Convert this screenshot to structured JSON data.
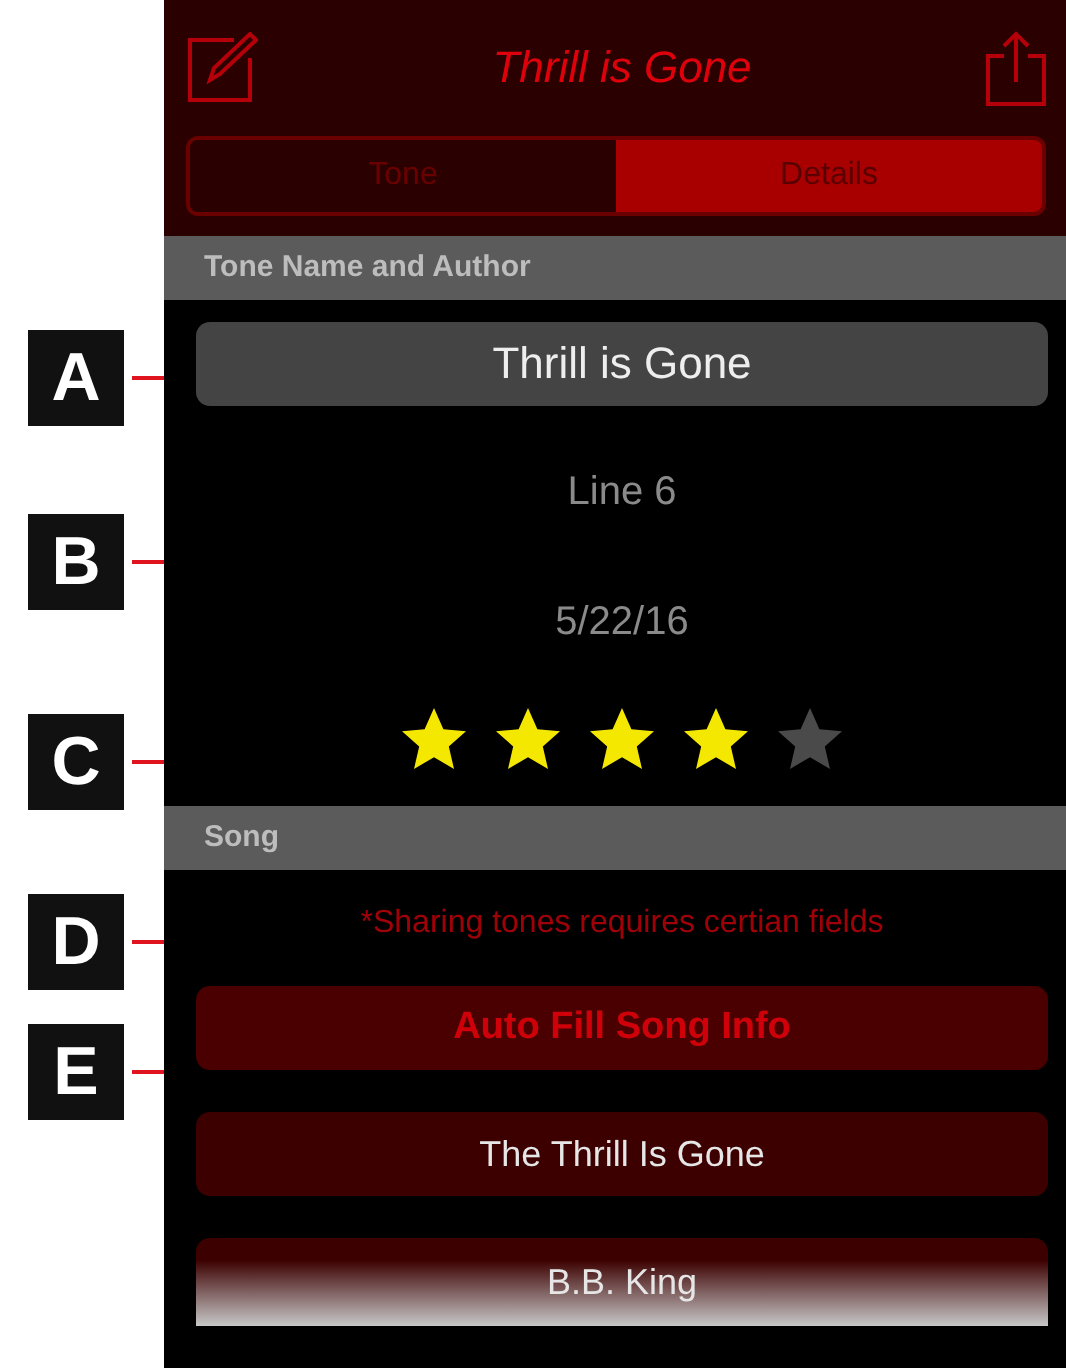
{
  "callouts": [
    {
      "letter": "A"
    },
    {
      "letter": "B"
    },
    {
      "letter": "C"
    },
    {
      "letter": "D"
    },
    {
      "letter": "E"
    }
  ],
  "nav": {
    "title": "Thrill is Gone"
  },
  "segments": [
    {
      "label": "Tone",
      "selected": false
    },
    {
      "label": "Details",
      "selected": true
    }
  ],
  "tone_section": {
    "header": "Tone Name and Author",
    "name_value": "Thrill is Gone",
    "author": "Line 6",
    "date": "5/22/16",
    "stars": 4
  },
  "song_section": {
    "header": "Song",
    "notice": "*Sharing tones requires certian fields",
    "auto_fill_button": "Auto Fill Song Info",
    "song_title_value": "The Thrill Is Gone",
    "artist_value": "B.B. King"
  }
}
